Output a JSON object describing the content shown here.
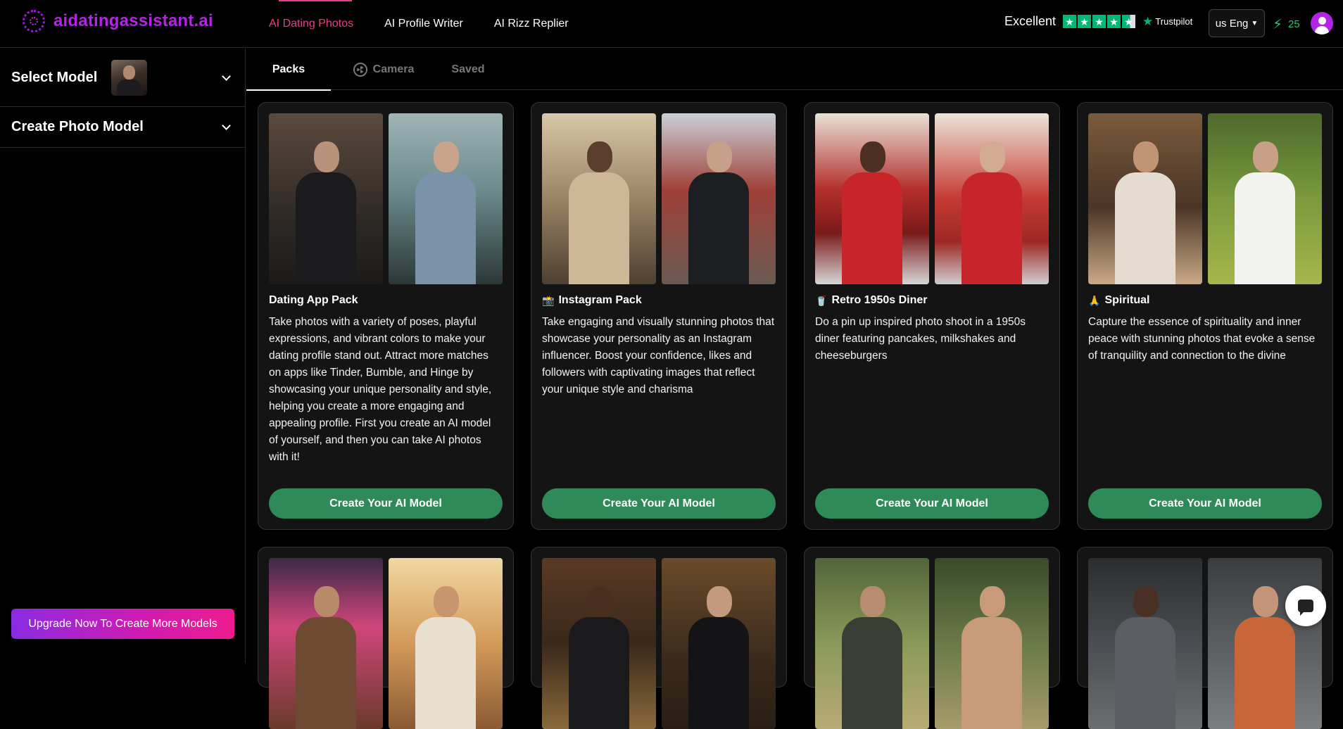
{
  "brand": {
    "name": "aidatingassistant.ai",
    "color": "#b324e6"
  },
  "nav": {
    "items": [
      {
        "label": "AI Dating Photos",
        "active": true
      },
      {
        "label": "AI Profile Writer",
        "active": false
      },
      {
        "label": "AI Rizz Replier",
        "active": false
      }
    ],
    "active_color": "#e83e8c"
  },
  "trustpilot": {
    "label": "Excellent",
    "brand": "Trustpilot",
    "stars": 4.5
  },
  "language": {
    "selected": "us Eng"
  },
  "credits": {
    "count": "25",
    "icon": "bolt-icon"
  },
  "sidebar": {
    "select_model": "Select Model",
    "create_photo_model": "Create Photo Model",
    "upgrade_label": "Upgrade Now To Create More Models"
  },
  "tabs": [
    {
      "label": "Packs",
      "active": true
    },
    {
      "label": "Camera",
      "active": false,
      "icon": "aperture-icon"
    },
    {
      "label": "Saved",
      "active": false
    }
  ],
  "packs": [
    {
      "title": "Dating App Pack",
      "emoji": "",
      "description": "Take photos with a variety of poses, playful expressions, and vibrant colors to make your dating profile stand out. Attract more matches on apps like Tinder, Bumble, and Hinge by showcasing your unique personality and style, helping you create a more engaging and appealing profile. First you create an AI model of yourself, and then you can take AI photos with it!",
      "cta": "Create Your AI Model"
    },
    {
      "title": "Instagram Pack",
      "emoji": "📸",
      "description": "Take engaging and visually stunning photos that showcase your personality as an Instagram influencer. Boost your confidence, likes and followers with captivating images that reflect your unique style and charisma",
      "cta": "Create Your AI Model"
    },
    {
      "title": "Retro 1950s Diner",
      "emoji": "🥤",
      "description": "Do a pin up inspired photo shoot in a 1950s diner featuring pancakes, milkshakes and cheeseburgers",
      "cta": "Create Your AI Model"
    },
    {
      "title": "Spiritual",
      "emoji": "🙏",
      "description": "Capture the essence of spirituality and inner peace with stunning photos that evoke a sense of tranquility and connection to the divine",
      "cta": "Create Your AI Model"
    }
  ],
  "cta_color": "#2e8b57"
}
